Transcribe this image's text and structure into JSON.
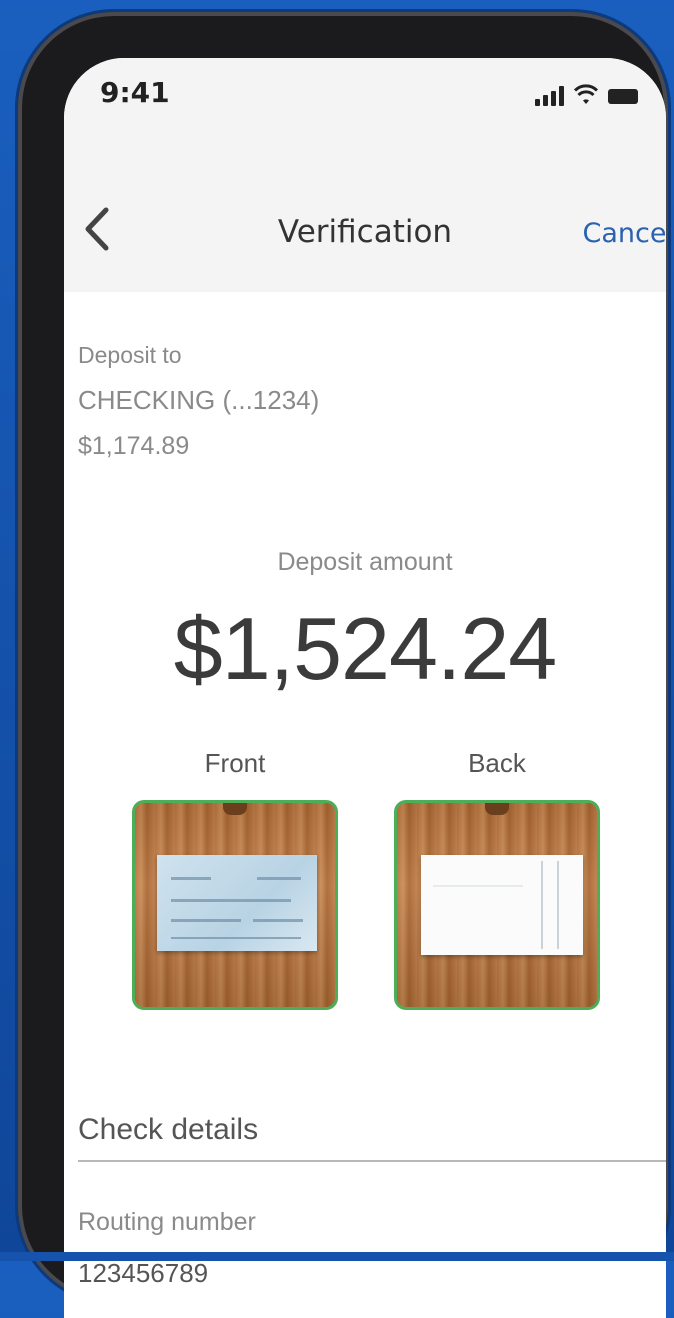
{
  "status_bar": {
    "time": "9:41"
  },
  "nav": {
    "title": "Verification",
    "back_icon": "chevron-left-icon",
    "cancel_label": "Cancel"
  },
  "deposit_to": {
    "label": "Deposit to",
    "account": "CHECKING (...1234)",
    "balance": "$1,174.89"
  },
  "deposit": {
    "label": "Deposit amount",
    "amount": "$1,524.24"
  },
  "images": {
    "front_label": "Front",
    "back_label": "Back"
  },
  "check_details": {
    "title": "Check details",
    "routing_label": "Routing number",
    "routing_value": "123456789"
  },
  "colors": {
    "accent": "#2a62b0",
    "thumb_border": "#4caf57",
    "background": "#1553ad"
  }
}
